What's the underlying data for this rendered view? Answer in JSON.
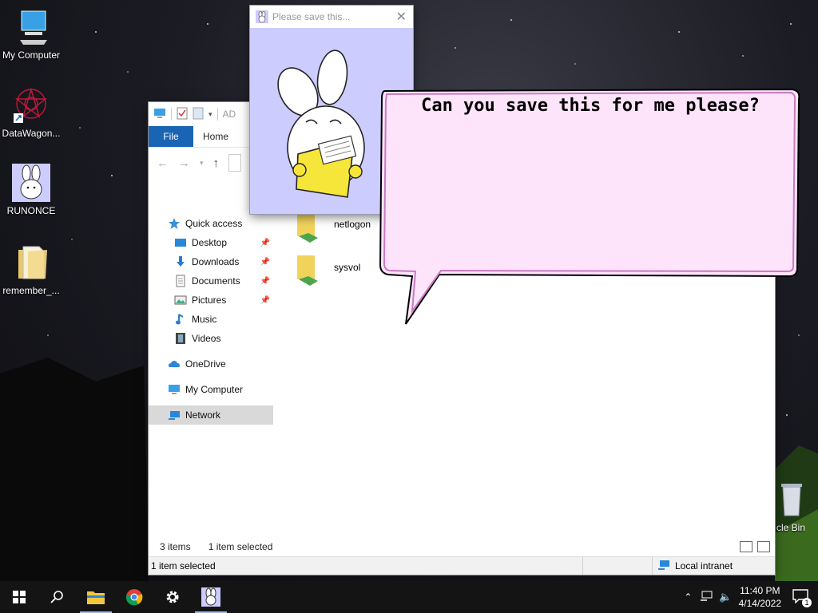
{
  "desktop": {
    "icons": [
      {
        "label": "My Computer"
      },
      {
        "label": "DataWagon..."
      },
      {
        "label": "RUNONCE"
      },
      {
        "label": "remember_..."
      },
      {
        "label": "cle Bin"
      }
    ]
  },
  "popup": {
    "title": "Please save this..."
  },
  "bubble": {
    "text": "Can you save this for me please?"
  },
  "explorer": {
    "qat_title_fragment": "AD",
    "ribbon": {
      "file_tab": "File",
      "home_tab": "Home"
    },
    "sidebar": {
      "quick_access": "Quick access",
      "items": [
        {
          "label": "Desktop",
          "pinned": true
        },
        {
          "label": "Downloads",
          "pinned": true
        },
        {
          "label": "Documents",
          "pinned": true
        },
        {
          "label": "Pictures",
          "pinned": true
        },
        {
          "label": "Music",
          "pinned": false
        },
        {
          "label": "Videos",
          "pinned": false
        }
      ],
      "onedrive": "OneDrive",
      "my_computer": "My Computer",
      "network": "Network"
    },
    "files": [
      {
        "name": "netlogon"
      },
      {
        "name": "sysvol"
      }
    ],
    "status": {
      "items_count": "3 items",
      "selected": "1 item selected",
      "bar_left": "1 item selected",
      "zone": "Local intranet"
    }
  },
  "taskbar": {
    "time": "11:40 PM",
    "date": "4/14/2022",
    "notification_count": "1"
  },
  "colors": {
    "ribbon_file": "#1a64b4",
    "popup_bg": "#ccccff",
    "bubble_fill": "#fde4fb",
    "bubble_outline": "#c77bc0"
  }
}
